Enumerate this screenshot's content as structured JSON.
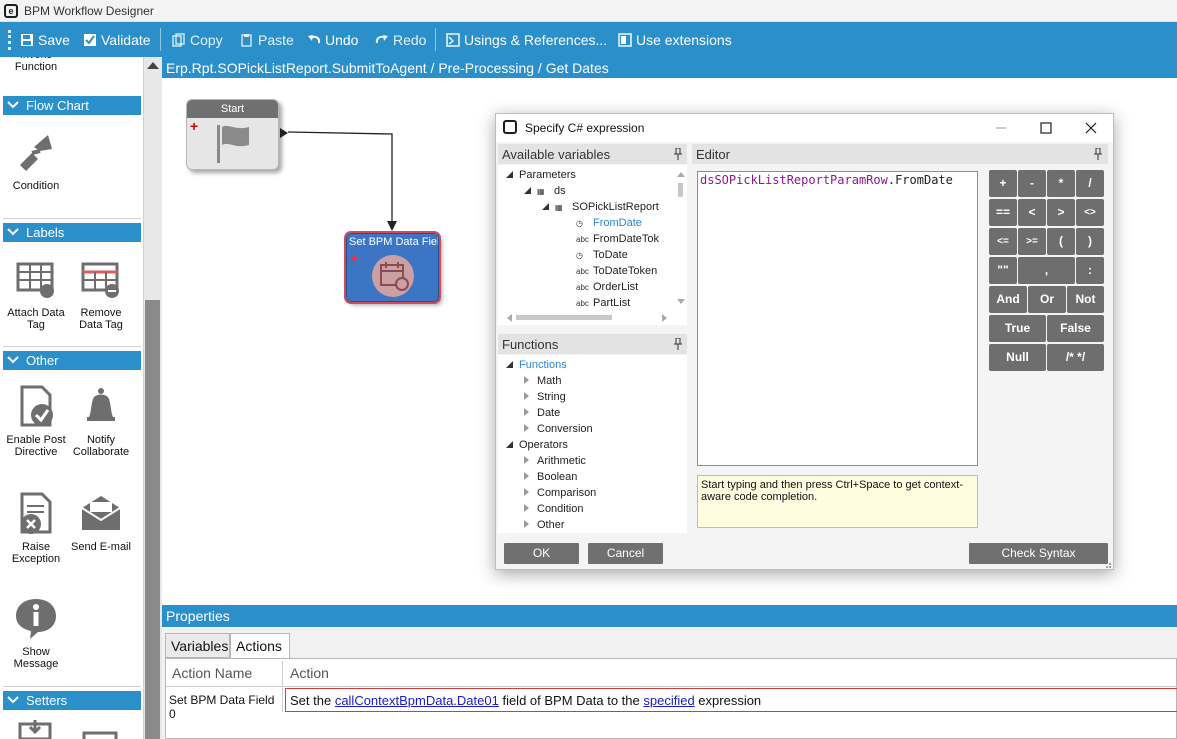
{
  "window": {
    "title": "BPM Workflow Designer"
  },
  "toolbar": {
    "save": "Save",
    "validate": "Validate",
    "copy": "Copy",
    "paste": "Paste",
    "undo": "Undo",
    "redo": "Redo",
    "usings": "Usings & References...",
    "extensions": "Use extensions"
  },
  "breadcrumb": "Erp.Rpt.SOPickListReport.SubmitToAgent / Pre-Processing / Get Dates",
  "toolbox": {
    "partial_item": "Invoke Function",
    "sections": {
      "flow_chart": "Flow Chart",
      "labels": "Labels",
      "other": "Other",
      "setters": "Setters"
    },
    "items": {
      "condition": "Condition",
      "attach_data_tag": "Attach Data Tag",
      "remove_data_tag": "Remove Data Tag",
      "enable_post_directive": "Enable Post Directive",
      "notify_collaborate": "Notify Collaborate",
      "raise_exception": "Raise Exception",
      "send_email": "Send E-mail",
      "show_message": "Show Message"
    }
  },
  "canvas": {
    "start_node": "Start",
    "set_node": "Set BPM Data Field"
  },
  "dialog": {
    "title": "Specify C# expression",
    "variables_header": "Available variables",
    "variables": {
      "parameters": "Parameters",
      "ds": "ds",
      "table": "SOPickListReport",
      "fields": [
        {
          "name": "FromDate",
          "type": "clock",
          "selected": true
        },
        {
          "name": "FromDateTok",
          "type": "abc"
        },
        {
          "name": "ToDate",
          "type": "clock"
        },
        {
          "name": "ToDateToken",
          "type": "abc"
        },
        {
          "name": "OrderList",
          "type": "abc"
        },
        {
          "name": "PartList",
          "type": "abc"
        }
      ]
    },
    "functions_header": "Functions",
    "functions": {
      "root": "Functions",
      "items": [
        "Math",
        "String",
        "Date",
        "Conversion"
      ],
      "operators": "Operators",
      "operator_items": [
        "Arithmetic",
        "Boolean",
        "Comparison",
        "Condition",
        "Other"
      ]
    },
    "editor_header": "Editor",
    "editor": {
      "object": "dsSOPickListReportParamRow",
      "member": ".FromDate"
    },
    "hint": "Start typing and then press Ctrl+Space to get context-aware code completion.",
    "keypad": {
      "row1": [
        "+",
        "-",
        "*",
        "/"
      ],
      "row2": [
        "==",
        "<",
        ">",
        "<>"
      ],
      "row3": [
        "<=",
        ">=",
        "(",
        ")"
      ],
      "row4": [
        "\"\"",
        ",",
        ":"
      ],
      "row5": [
        "And",
        "Or",
        "Not"
      ],
      "row6": [
        "True",
        "False"
      ],
      "row7": [
        "Null",
        "/* */"
      ]
    },
    "ok": "OK",
    "cancel": "Cancel",
    "check_syntax": "Check Syntax"
  },
  "properties": {
    "header": "Properties",
    "tabs": [
      "Variables",
      "Actions"
    ],
    "columns": [
      "Action Name",
      "Action"
    ],
    "row": {
      "name": "Set BPM Data Field 0",
      "text_before": "Set the ",
      "link1": "callContextBpmData.Date01",
      "text_middle": " field of BPM Data to the ",
      "link2": "specified",
      "text_after": " expression"
    }
  }
}
